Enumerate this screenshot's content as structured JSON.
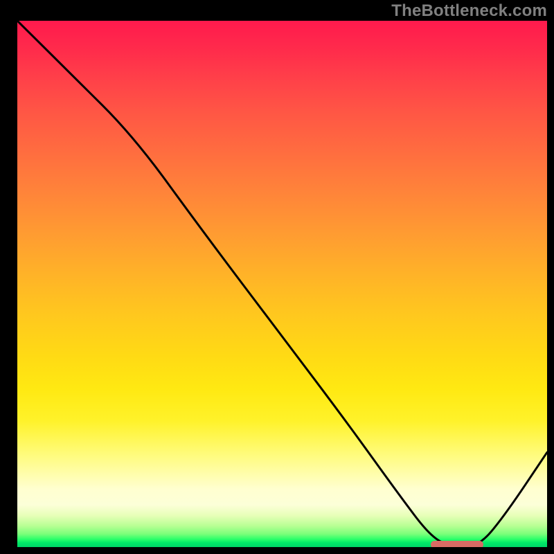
{
  "watermark": "TheBottleneck.com",
  "chart_data": {
    "type": "line",
    "title": "",
    "xlabel": "",
    "ylabel": "",
    "xlim": [
      0,
      100
    ],
    "ylim": [
      0,
      100
    ],
    "grid": false,
    "series": [
      {
        "name": "curve",
        "x": [
          0,
          10,
          22,
          35,
          50,
          62,
          72,
          78,
          82,
          87,
          92,
          100
        ],
        "y": [
          100,
          90,
          78,
          60,
          40,
          24,
          10,
          2,
          0,
          0,
          6,
          18
        ]
      }
    ],
    "marker_segment": {
      "x_start": 78,
      "x_end": 88,
      "y": 0.5
    },
    "gradient_stops": [
      {
        "pos": 0,
        "color": "#ff1a4d"
      },
      {
        "pos": 50,
        "color": "#ffb228"
      },
      {
        "pos": 80,
        "color": "#fffb77"
      },
      {
        "pos": 98,
        "color": "#2cff6a"
      },
      {
        "pos": 100,
        "color": "#00d567"
      }
    ]
  }
}
